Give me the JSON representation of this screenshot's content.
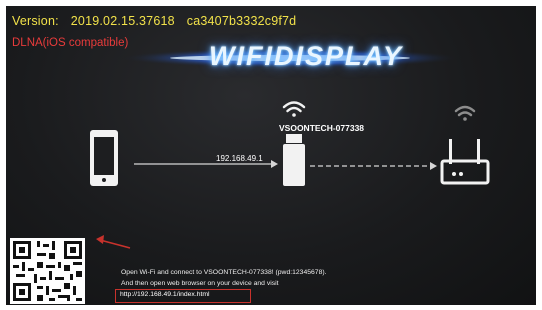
{
  "header": {
    "version_label": "Version:",
    "version_value": "2019.02.15.37618",
    "build_hash": "ca3407b3332c9f7d",
    "dlna_text": "DLNA(iOS compatible)"
  },
  "logo": {
    "text": "WIFIDISPLAY"
  },
  "diagram": {
    "ip_address": "192.168.49.1",
    "device_ssid": "VSOONTECH-077338"
  },
  "instructions": {
    "line1": "Open Wi-Fi and connect to   VSOONTECH-077338! (pwd:12345678).",
    "line2": "And then open web browser on your device and visit",
    "url": "http://192.168.49.1/index.html"
  },
  "colors": {
    "version": "#f2e24a",
    "dlna": "#e83b3b",
    "arrow_annotation": "#c8322c",
    "background": "#17181a"
  },
  "icons": [
    "phone-icon",
    "wifi-icon",
    "dongle-icon",
    "router-icon",
    "qr-code",
    "red-arrow"
  ]
}
